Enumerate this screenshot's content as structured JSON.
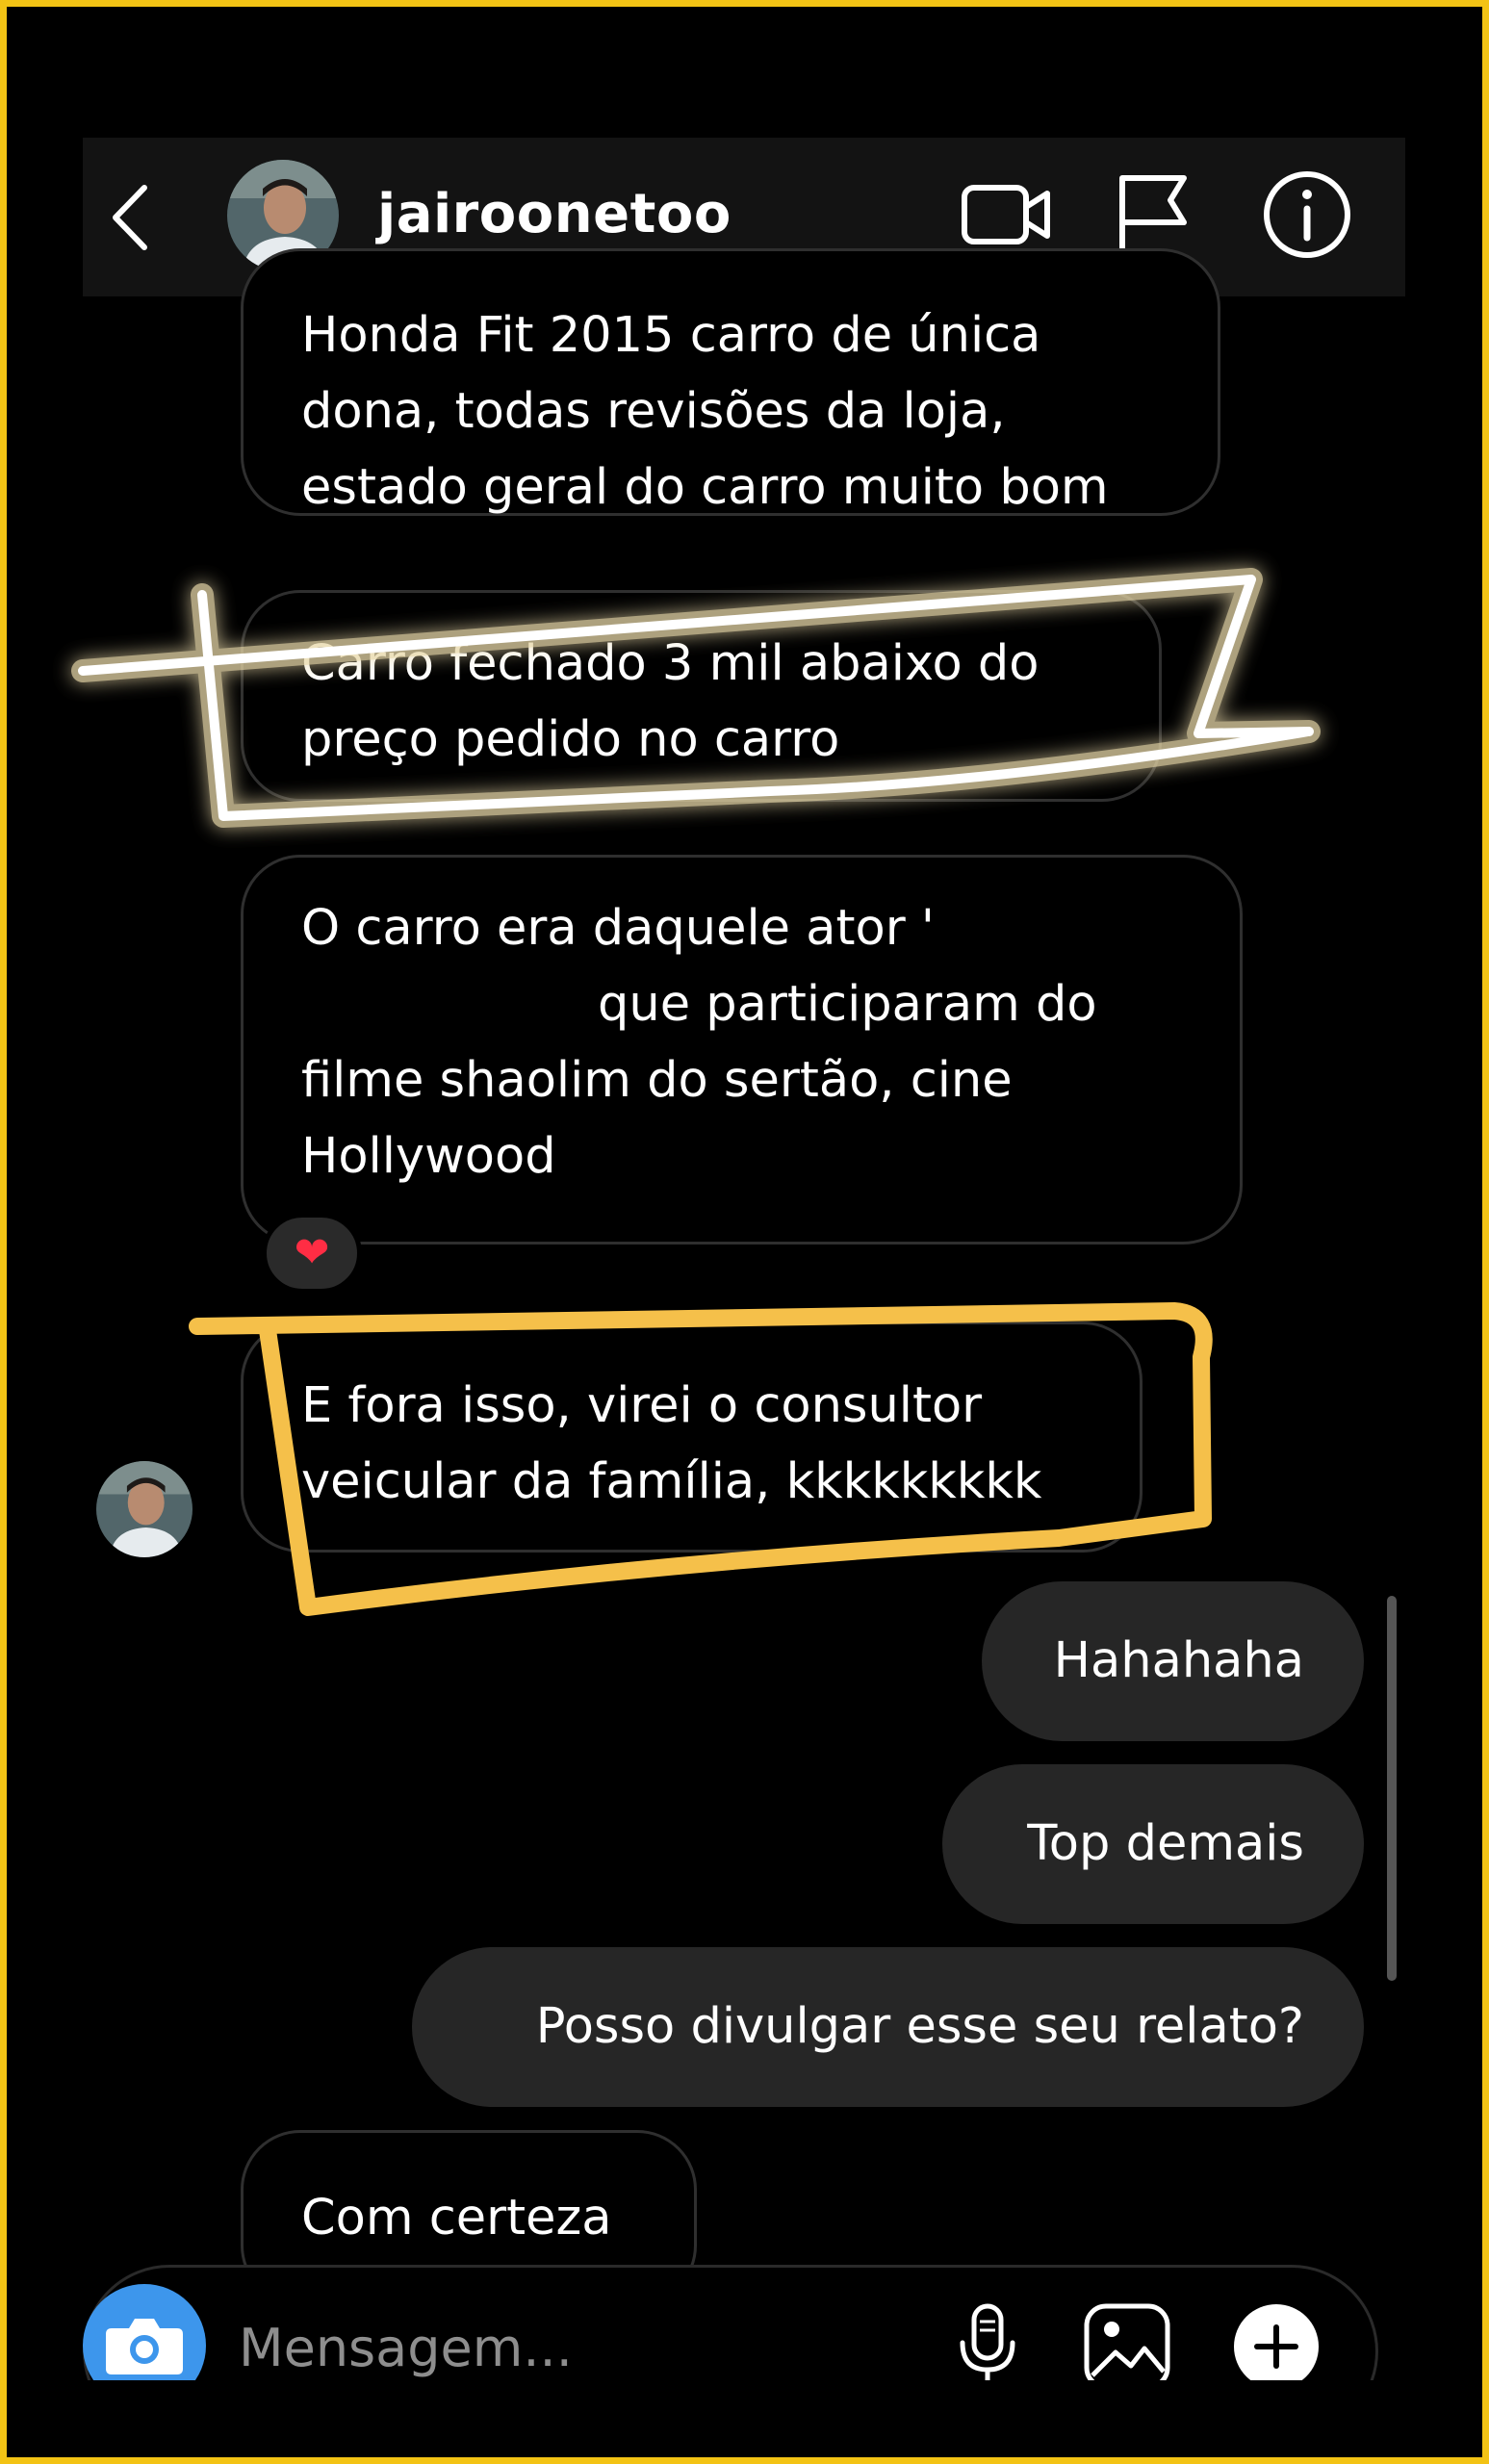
{
  "header": {
    "username": "jairoonetoo",
    "icons": [
      "back-arrow-icon",
      "video-call-icon",
      "flag-icon",
      "info-icon"
    ]
  },
  "messages": {
    "received_1": [
      "Honda Fit 2015 carro de única",
      "dona, todas revisões da loja,",
      "estado geral do carro muito bom"
    ],
    "received_2": [
      "Carro fechado 3 mil abaixo do",
      "preço pedido no carro"
    ],
    "received_3": [
      "O carro era daquele ator '",
      "que participaram do",
      "filme shaolim do sertão, cine",
      "Hollywood"
    ],
    "reaction": "❤",
    "received_4": [
      "E fora isso, virei o consultor",
      "veicular da família, kkkkkkkkk"
    ],
    "sent_1": "Hahahaha",
    "sent_2": "Top demais",
    "sent_3": "Posso divulgar esse seu relato?",
    "received_5": "Com certeza"
  },
  "composer": {
    "placeholder": "Mensagem...",
    "icons": [
      "camera-icon",
      "microphone-icon",
      "gallery-icon",
      "plus-icon"
    ]
  },
  "colors": {
    "frame": "#f3c315",
    "highlight_white_glow": "#ffffff",
    "highlight_yellow": "#f5c04a",
    "sent_bubble": "#262626",
    "camera_button": "#3d96ec"
  }
}
